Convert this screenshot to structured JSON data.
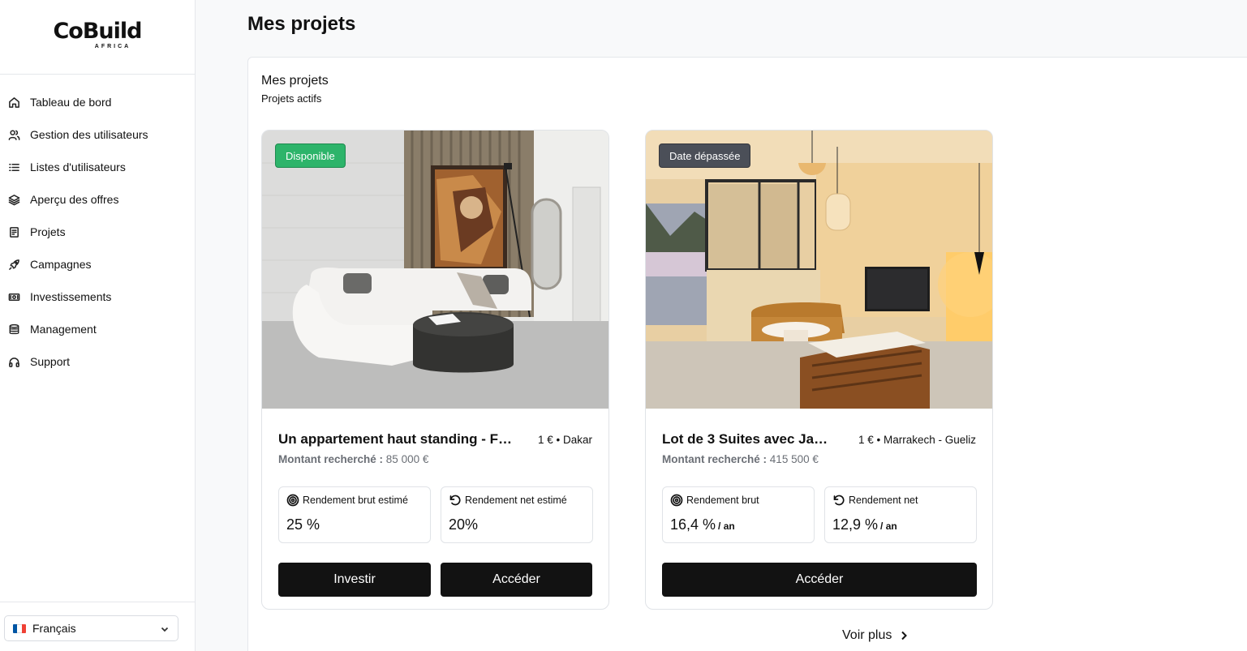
{
  "brand": {
    "name": "CoBuild",
    "sub": "AFRICA"
  },
  "sidebar": {
    "items": [
      {
        "label": "Tableau de bord",
        "icon": "home-icon"
      },
      {
        "label": "Gestion des utilisateurs",
        "icon": "users-icon"
      },
      {
        "label": "Listes d'utilisateurs",
        "icon": "list-icon"
      },
      {
        "label": "Aperçu des offres",
        "icon": "layers-icon"
      },
      {
        "label": "Projets",
        "icon": "document-icon"
      },
      {
        "label": "Campagnes",
        "icon": "rocket-icon"
      },
      {
        "label": "Investissements",
        "icon": "money-icon"
      },
      {
        "label": "Management",
        "icon": "database-icon"
      },
      {
        "label": "Support",
        "icon": "headphones-icon"
      }
    ],
    "language": {
      "label": "Français",
      "flag": [
        "#0055A4",
        "#FFFFFF",
        "#EF4135"
      ]
    }
  },
  "page": {
    "title": "Mes projets"
  },
  "panel": {
    "title": "Mes projets",
    "subtitle": "Projets actifs"
  },
  "projects": [
    {
      "badge": "Disponible",
      "badge_color": "#2db46a",
      "title": "Un appartement haut standing - F…",
      "location": "1 € • Dakar",
      "amount_label": "Montant recherché :",
      "amount": "85 000 €",
      "stats": [
        {
          "label": "Rendement brut estimé",
          "icon": "target-icon",
          "value": "25 %",
          "unit": ""
        },
        {
          "label": "Rendement net estimé",
          "icon": "rotate-ccw-icon",
          "value": "20%",
          "unit": ""
        }
      ],
      "buttons": [
        "Investir",
        "Accéder"
      ]
    },
    {
      "badge": "Date dépassée",
      "badge_color": "#4b4f58",
      "title": "Lot de 3 Suites avec Ja…",
      "location": "1 € • Marrakech - Gueliz",
      "amount_label": "Montant recherché :",
      "amount": "415 500 €",
      "stats": [
        {
          "label": "Rendement brut",
          "icon": "target-icon",
          "value": "16,4 %",
          "unit": "/ an"
        },
        {
          "label": "Rendement net",
          "icon": "rotate-ccw-icon",
          "value": "12,9 %",
          "unit": "/ an"
        }
      ],
      "buttons": [
        "Accéder"
      ]
    }
  ],
  "more": {
    "label": "Voir plus"
  }
}
